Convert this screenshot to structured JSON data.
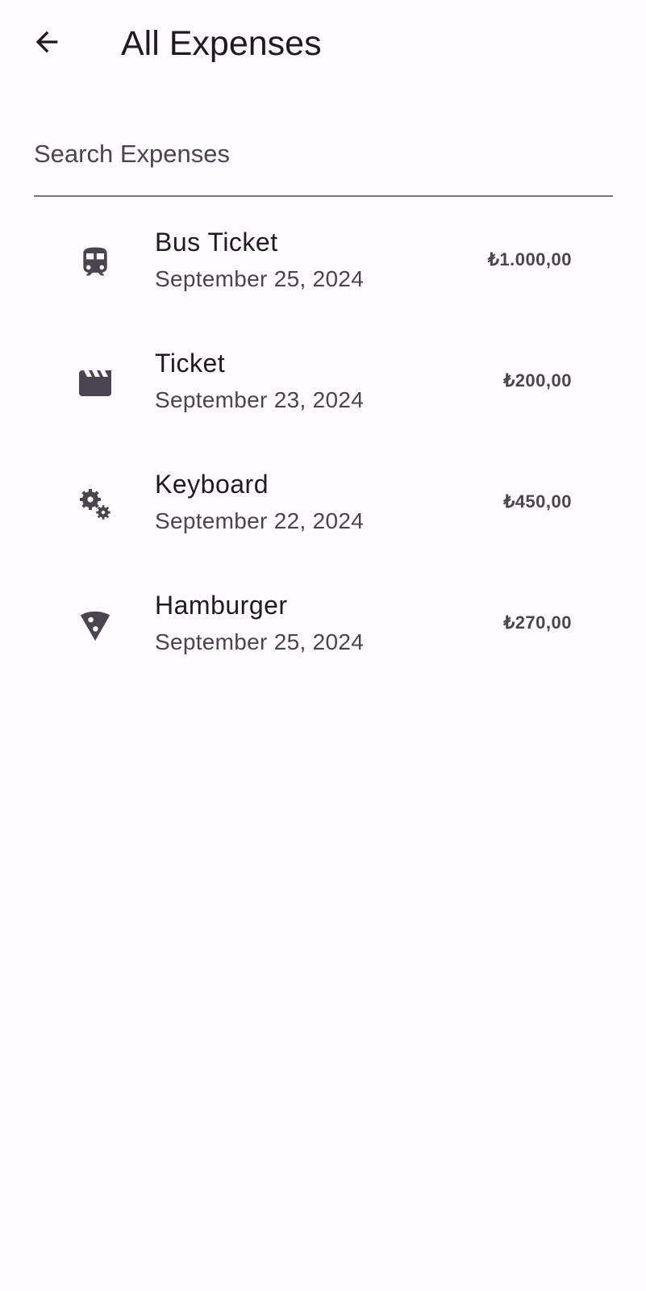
{
  "header": {
    "title": "All Expenses",
    "back_icon": "arrow-back-icon"
  },
  "search": {
    "placeholder": "Search Expenses",
    "value": ""
  },
  "expenses": [
    {
      "title": "Bus Ticket",
      "date": "September 25, 2024",
      "amount": "₺1.000,00",
      "icon": "train-icon"
    },
    {
      "title": "Ticket",
      "date": "September 23, 2024",
      "amount": "₺200,00",
      "icon": "movie-clapperboard-icon"
    },
    {
      "title": "Keyboard",
      "date": "September 22, 2024",
      "amount": "₺450,00",
      "icon": "settings-gears-icon"
    },
    {
      "title": "Hamburger",
      "date": "September 25, 2024",
      "amount": "₺270,00",
      "icon": "pizza-slice-icon"
    }
  ],
  "colors": {
    "background": "#fffbfe",
    "text_primary": "#1d1b20",
    "text_secondary": "#49454f",
    "icon": "#49454f",
    "divider": "#79747e"
  }
}
